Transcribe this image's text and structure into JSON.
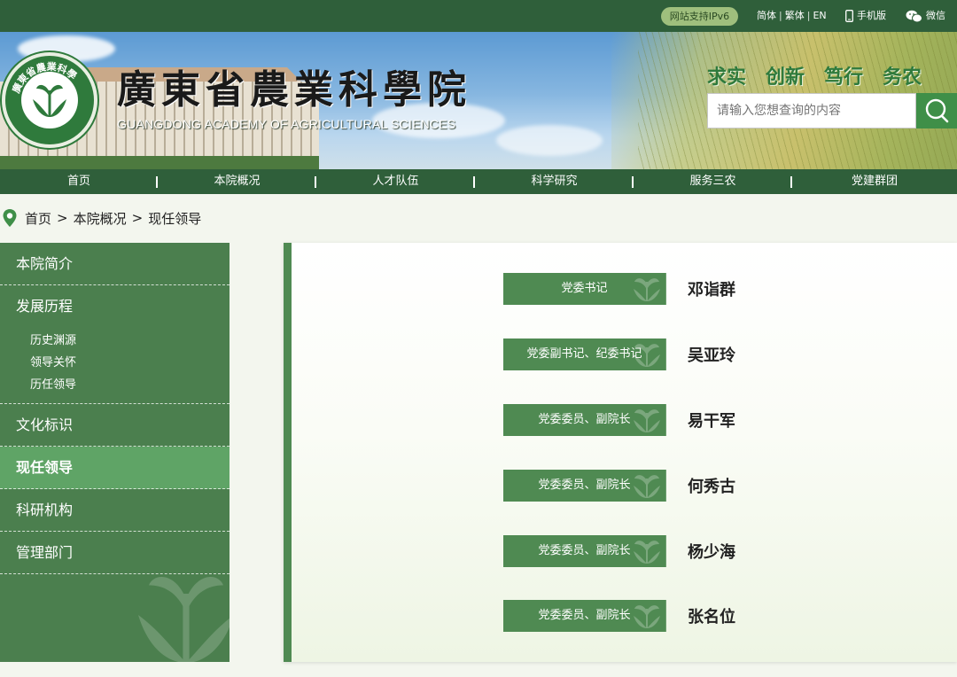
{
  "topbar": {
    "ipv6_label": "网站支持IPv6",
    "lang_simplified": "简体",
    "lang_traditional": "繁体",
    "lang_english": "EN",
    "mobile_label": "手机版",
    "wechat_label": "微信"
  },
  "banner": {
    "logo_title": "廣東省農業科學院",
    "logo_subtitle": "GUANGDONG ACADEMY OF AGRICULTURAL SCIENCES",
    "seal_text": "廣東省農業科學",
    "mottos": [
      "求实",
      "创新",
      "笃行",
      "务农"
    ]
  },
  "search": {
    "placeholder": "请输入您想查询的内容"
  },
  "nav": {
    "items": [
      "首页",
      "本院概况",
      "人才队伍",
      "科学研究",
      "服务三农",
      "党建群团"
    ]
  },
  "breadcrumb": {
    "items": [
      "首页",
      "本院概况",
      "现任领导"
    ],
    "separator": ">"
  },
  "sidebar": {
    "intro": "本院简介",
    "history": "发展历程",
    "history_sub": [
      "历史渊源",
      "领导关怀",
      "历任领导"
    ],
    "culture": "文化标识",
    "current_leaders": "现任领导",
    "research": "科研机构",
    "management": "管理部门"
  },
  "leaders": [
    {
      "role": "党委书记",
      "name": "邓诣群"
    },
    {
      "role": "党委副书记、纪委书记",
      "name": "吴亚玲"
    },
    {
      "role": "党委委员、副院长",
      "name": "易干军"
    },
    {
      "role": "党委委员、副院长",
      "name": "何秀古"
    },
    {
      "role": "党委委员、副院长",
      "name": "杨少海"
    },
    {
      "role": "党委委员、副院长",
      "name": "张名位"
    }
  ],
  "colors": {
    "dark_green": "#2f5f3a",
    "sidebar_green": "#4b7f4e",
    "active_green": "#5fa466",
    "accent_green": "#3f8f48"
  }
}
